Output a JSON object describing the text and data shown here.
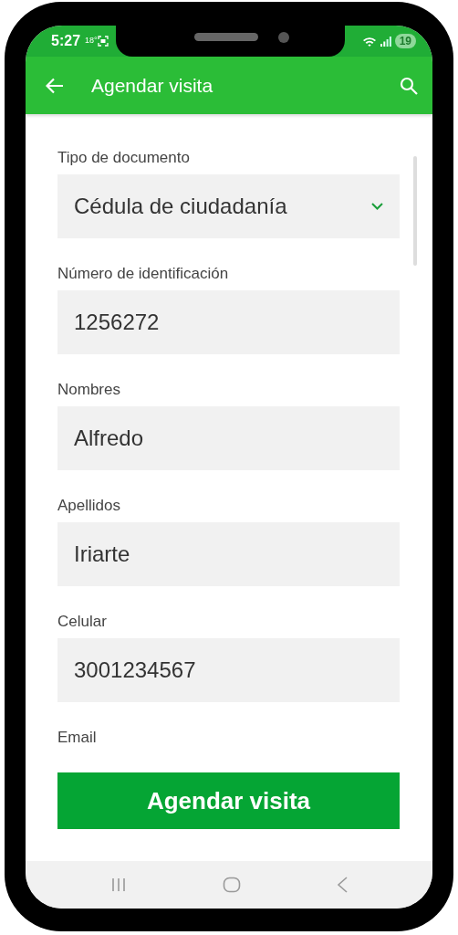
{
  "status_bar": {
    "time": "5:27",
    "temperature": "18°",
    "battery": "19"
  },
  "app_bar": {
    "title": "Agendar visita"
  },
  "fields": [
    {
      "kind": "select",
      "label": "Tipo de documento",
      "value": "Cédula de ciudadanía"
    },
    {
      "kind": "text",
      "label": "Número de identificación",
      "value": "1256272"
    },
    {
      "kind": "text",
      "label": "Nombres",
      "value": "Alfredo"
    },
    {
      "kind": "text",
      "label": "Apellidos",
      "value": "Iriarte"
    },
    {
      "kind": "text",
      "label": "Celular",
      "value": "3001234567"
    },
    {
      "kind": "label_only",
      "label": "Email"
    }
  ],
  "submit_button": {
    "label": "Agendar visita"
  }
}
